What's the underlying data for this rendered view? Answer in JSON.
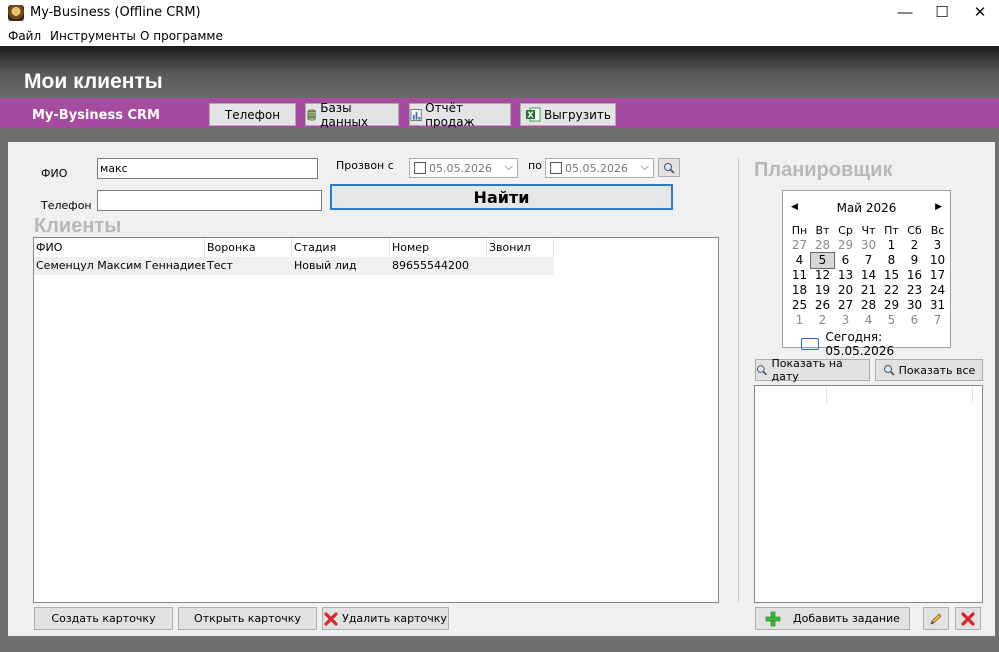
{
  "window": {
    "title": "My-Business (Offline CRM)",
    "minimize": "—",
    "maximize": "☐",
    "close": "✕"
  },
  "menu": [
    "Файл",
    "Инструменты",
    "О программе"
  ],
  "header": {
    "title": "Мои клиенты"
  },
  "toolbar": {
    "brand": "My-Bysiness CRM",
    "phone": "Телефон",
    "databases": "Базы данных",
    "sales_report": "Отчёт продаж",
    "export": "Выгрузить"
  },
  "search": {
    "fio_label": "ФИО",
    "fio_value": "макс",
    "phone_label": "Телефон",
    "phone_value": "",
    "call_from_label": "Прозвон с",
    "call_from_date": "05.05.2026",
    "call_to_label": "по",
    "call_to_date": "05.05.2026",
    "find_button": "Найти"
  },
  "clients": {
    "title": "Клиенты",
    "columns": [
      "ФИО",
      "Воронка",
      "Стадия",
      "Номер",
      "Звонил"
    ],
    "rows": [
      [
        "Семенцул Максим Геннадиевич",
        "Тест",
        "Новый лид",
        "89655544200",
        ""
      ]
    ]
  },
  "actions": {
    "create": "Создать карточку",
    "open": "Открыть карточку",
    "delete": "Удалить карточку"
  },
  "planner": {
    "title": "Планировщик",
    "month": "Май 2026",
    "weekdays": [
      "Пн",
      "Вт",
      "Ср",
      "Чт",
      "Пт",
      "Сб",
      "Вс"
    ],
    "weeks": [
      [
        "27",
        "28",
        "29",
        "30",
        "1",
        "2",
        "3"
      ],
      [
        "4",
        "5",
        "6",
        "7",
        "8",
        "9",
        "10"
      ],
      [
        "11",
        "12",
        "13",
        "14",
        "15",
        "16",
        "17"
      ],
      [
        "18",
        "19",
        "20",
        "21",
        "22",
        "23",
        "24"
      ],
      [
        "25",
        "26",
        "27",
        "28",
        "29",
        "30",
        "31"
      ],
      [
        "1",
        "2",
        "3",
        "4",
        "5",
        "6",
        "7"
      ]
    ],
    "selected_day": "5",
    "today_label": "Сегодня: 05.05.2026",
    "show_by_date": "Показать на дату",
    "show_all": "Показать все",
    "add_task": "Добавить задание"
  },
  "colors": {
    "brand_purple": "#a54ca0",
    "accent_blue": "#2b79c7",
    "header_dark": "#1c1c1c"
  }
}
